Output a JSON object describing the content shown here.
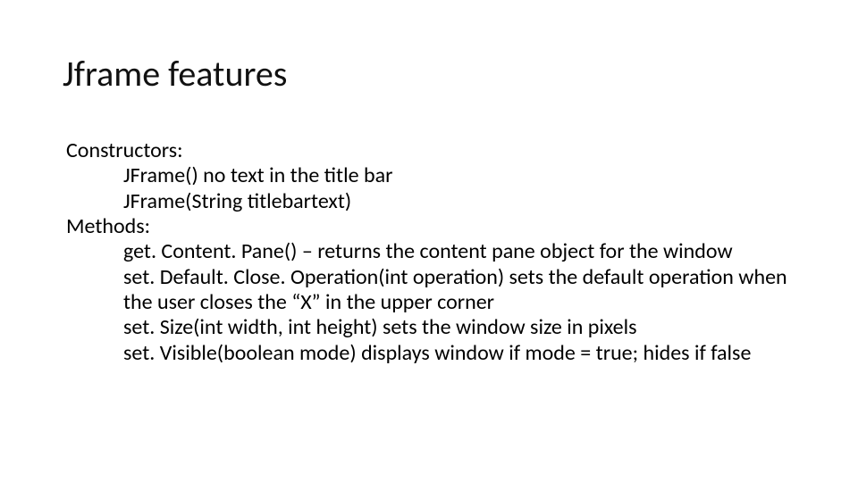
{
  "title": "Jframe features",
  "body": {
    "constructors_label": "Constructors:",
    "ctor1": "JFrame() no text in the title bar",
    "ctor2": "JFrame(String titlebartext)",
    "methods_label": "Methods:",
    "m1": "get. Content. Pane() – returns the content pane object for the window",
    "m2": "set. Default. Close. Operation(int operation) sets the default operation when the user closes the “X” in the upper corner",
    "m3": "set. Size(int width, int height) sets the window size in pixels",
    "m4": "set. Visible(boolean mode) displays window if mode = true; hides if false"
  }
}
